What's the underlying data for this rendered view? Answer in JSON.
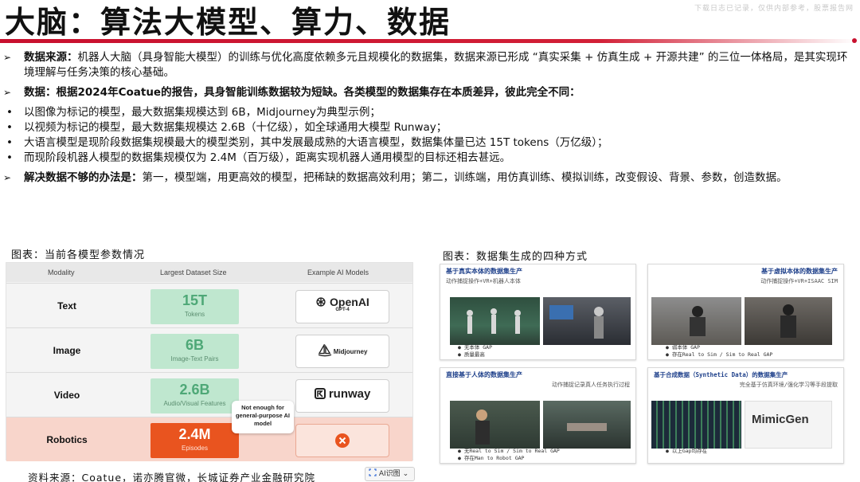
{
  "watermark": "下载日志已记录，仅供内部参考，股票报告网",
  "title": "大脑：算法大模型、算力、数据",
  "intro": {
    "marker": "➢",
    "label": "数据来源：",
    "text": "机器人大脑（具身智能大模型）的训练与优化高度依赖多元且规模化的数据集，数据来源已形成 “真实采集 + 仿真生成 + 开源共建” 的三位一体格局，是其实现环境理解与任务决策的核心基础。"
  },
  "data_section": {
    "marker": "➢",
    "text": "数据：根据2024年Coatue的报告，具身智能训练数据较为短缺。各类模型的数据集存在本质差异，彼此完全不同："
  },
  "bullets": [
    "以图像为标记的模型，最大数据集规模达到 6B，Midjourney为典型示例；",
    "以视频为标记的模型，最大数据集规模达 2.6B（十亿级），如全球通用大模型 Runway；",
    "大语言模型是现阶段数据集规模最大的模型类别，其中发展最成熟的大语言模型，数据集体量已达 15T tokens（万亿级）；",
    "而现阶段机器人模型的数据集规模仅为 2.4M（百万级），距离实现机器人通用模型的目标还相去甚远。"
  ],
  "bullet_dot": "•",
  "solution": {
    "marker": "➢",
    "label": "解决数据不够的办法是：",
    "text": "第一，模型端，用更高效的模型，把稀缺的数据高效利用；第二，训练端，用仿真训练、模拟训练，改变假设、背景、参数，创造数据。"
  },
  "left_caption": "图表：当前各模型参数情况",
  "right_caption": "图表：数据集生成的四种方式",
  "table": {
    "headers": [
      "Modality",
      "Largest Dataset Size",
      "Example AI Models"
    ],
    "rows": [
      {
        "modality": "Text",
        "size": "15T",
        "unit": "Tokens",
        "model": "OpenAI",
        "model_sub": "GPT-4"
      },
      {
        "modality": "Image",
        "size": "6B",
        "unit": "Image-Text Pairs",
        "model": "Midjourney",
        "model_sub": ""
      },
      {
        "modality": "Video",
        "size": "2.6B",
        "unit": "Audio/Visual Features",
        "model": "runway",
        "model_sub": ""
      },
      {
        "modality": "Robotics",
        "size": "2.4M",
        "unit": "Episodes",
        "model": "",
        "model_sub": ""
      }
    ],
    "tooltip": "Not enough for general-purpose AI model",
    "colors": {
      "green_fill": "#bfe7cf",
      "green_text": "#4ea877",
      "robot_fill": "#e9541f",
      "robot_row": "#f8d5cb"
    }
  },
  "panels": [
    {
      "title": "基于真实本体的数据集生产",
      "sub": "动作捕捉操作+VR+机器人本体",
      "notes": [
        "无本体 GAP",
        "质量最高"
      ]
    },
    {
      "title": "基于虚拟本体的数据集生产",
      "sub": "动作捕捉操作+VR+ISAAC SIM",
      "notes": [
        "弱本体 GAP",
        "存在Real to Sim / Sim to Real GAP"
      ]
    },
    {
      "title": "直接基于人体的数据集生产",
      "sub": "动作捕捉记录真人任务执行过程",
      "notes": [
        "无Real to Sim / Sim to Real GAP",
        "存在Man to Robot GAP"
      ]
    },
    {
      "title": "基于合成数据（Synthetic Data）的数据集生产",
      "sub": "完全基于仿真环境/强化学习等手段提取",
      "notes": [
        "以上Gap均存在"
      ]
    }
  ],
  "mimicgen": "MimicGen",
  "source": "资料来源：Coatue，诺亦腾官微，长城证券产业金融研究院",
  "ai_button": "AI识图"
}
